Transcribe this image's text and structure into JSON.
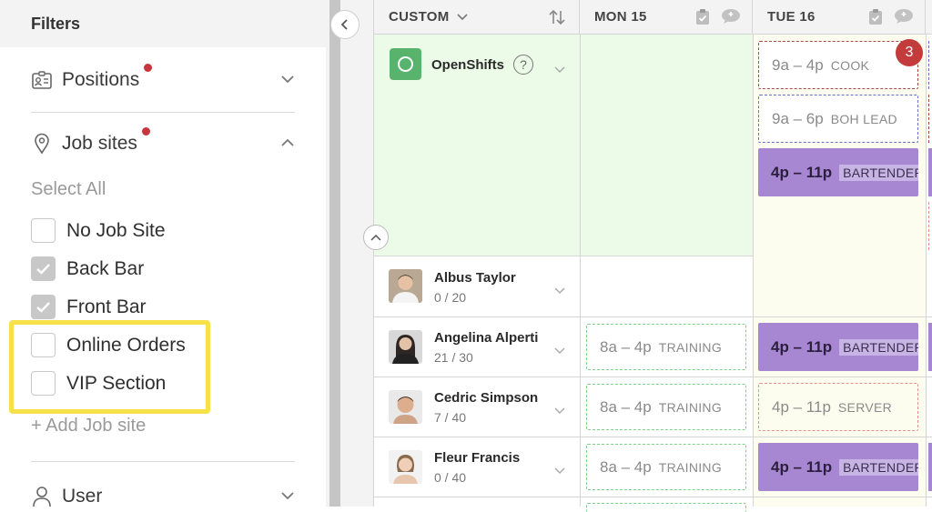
{
  "sidebar": {
    "title": "Filters",
    "positions": {
      "label": "Positions",
      "has_active_filter": true
    },
    "job_sites": {
      "label": "Job sites",
      "has_active_filter": true,
      "select_all": "Select All",
      "options": [
        {
          "label": "No Job Site",
          "checked": false
        },
        {
          "label": "Back Bar",
          "checked": true
        },
        {
          "label": "Front Bar",
          "checked": true
        },
        {
          "label": "Online Orders",
          "checked": false
        },
        {
          "label": "VIP Section",
          "checked": false
        }
      ],
      "add_label": "+ Add Job site"
    },
    "user": {
      "label": "User"
    }
  },
  "grid": {
    "sort_label": "CUSTOM",
    "days": [
      {
        "label": "MON 15"
      },
      {
        "label": "TUE 16"
      }
    ],
    "open_shifts": {
      "title": "OpenShifts",
      "help": "?",
      "badge_count": "3",
      "shifts": [
        {
          "time": "9a – 4p",
          "role": "COOK",
          "style": "cook"
        },
        {
          "time": "9a – 6p",
          "role": "BOH LEAD",
          "style": "boh"
        },
        {
          "time": "4p – 11p",
          "role": "BARTENDER",
          "style": "bartender"
        }
      ]
    },
    "employees": [
      {
        "name": "Albus Taylor",
        "hours": "0 / 20",
        "mon": null,
        "tue": null
      },
      {
        "name": "Angelina Alperti",
        "hours": "21 / 30",
        "mon": {
          "time": "8a – 4p",
          "role": "TRAINING",
          "style": "training"
        },
        "tue": {
          "time": "4p – 11p",
          "role": "BARTENDER",
          "style": "bartender"
        }
      },
      {
        "name": "Cedric Simpson",
        "hours": "7 / 40",
        "mon": {
          "time": "8a – 4p",
          "role": "TRAINING",
          "style": "training"
        },
        "tue": {
          "time": "4p – 11p",
          "role": "SERVER",
          "style": "server"
        }
      },
      {
        "name": "Fleur Francis",
        "hours": "0 / 40",
        "mon": {
          "time": "8a – 4p",
          "role": "TRAINING",
          "style": "training"
        },
        "tue": {
          "time": "4p – 11p",
          "role": "BARTENDER",
          "style": "bartender"
        }
      }
    ]
  },
  "colors": {
    "openshift_bg": "#ebfbe7",
    "bartender": "#a887d2",
    "training_border": "#7fd088",
    "cook_border": "#a44d45",
    "boh_border": "#6a6fc2",
    "server_border": "#e3938a",
    "alert_dot": "#c6363c",
    "highlight": "#f7e04a"
  }
}
